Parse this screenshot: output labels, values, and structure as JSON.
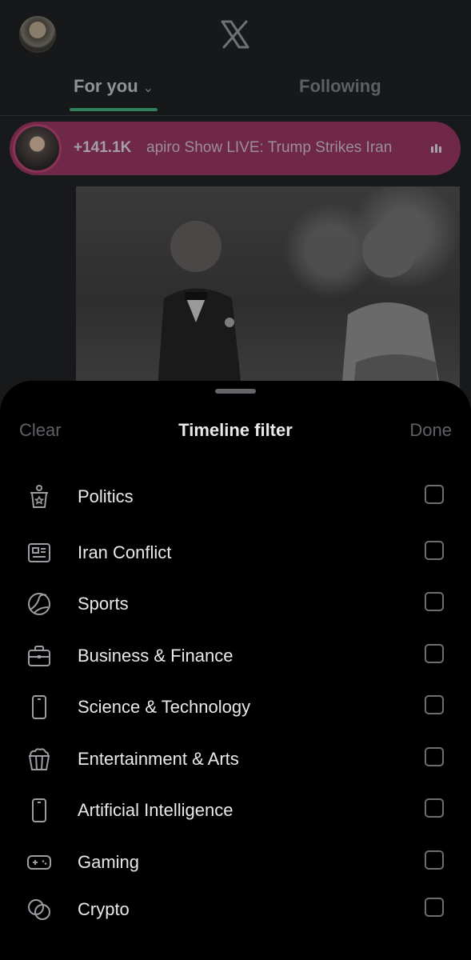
{
  "header": {
    "logo_icon": "x-logo-icon",
    "avatar_icon": "profile-avatar"
  },
  "tabs": [
    {
      "label": "For you",
      "selected": true,
      "has_dropdown": true
    },
    {
      "label": "Following",
      "selected": false
    }
  ],
  "live_banner": {
    "count": "+141.1K",
    "title": "apiro Show LIVE: Trump Strikes Iran",
    "icon": "live-audio-bars-icon",
    "color": "#6f2848"
  },
  "sheet": {
    "clear_label": "Clear",
    "title": "Timeline filter",
    "done_label": "Done",
    "items": [
      {
        "label": "Politics",
        "icon": "politics-podium-icon",
        "checked": false
      },
      {
        "label": "Iran Conflict",
        "icon": "news-icon",
        "checked": false
      },
      {
        "label": "Sports",
        "icon": "sports-ball-icon",
        "checked": false
      },
      {
        "label": "Business & Finance",
        "icon": "briefcase-icon",
        "checked": false
      },
      {
        "label": "Science & Technology",
        "icon": "phone-icon",
        "checked": false
      },
      {
        "label": "Entertainment & Arts",
        "icon": "popcorn-icon",
        "checked": false
      },
      {
        "label": "Artificial Intelligence",
        "icon": "phone-icon",
        "checked": false
      },
      {
        "label": "Gaming",
        "icon": "gamepad-icon",
        "checked": false
      },
      {
        "label": "Crypto",
        "icon": "coins-icon",
        "checked": false
      }
    ]
  },
  "colors": {
    "accent_green": "#2f7f5a",
    "sheet_background": "#000000",
    "muted_text": "#5e6166"
  }
}
